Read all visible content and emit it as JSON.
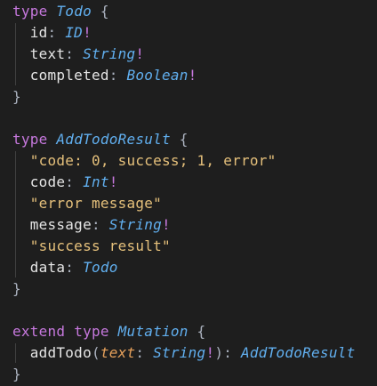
{
  "lines": [
    [
      {
        "t": "type",
        "c": "kw"
      },
      {
        "t": " ",
        "c": "pn"
      },
      {
        "t": "Todo",
        "c": "ty"
      },
      {
        "t": " {",
        "c": "pn"
      }
    ],
    [
      {
        "t": "  ",
        "c": "pn"
      },
      {
        "t": "id",
        "c": "fd"
      },
      {
        "t": ": ",
        "c": "pn"
      },
      {
        "t": "ID",
        "c": "ty"
      },
      {
        "t": "!",
        "c": "op"
      }
    ],
    [
      {
        "t": "  ",
        "c": "pn"
      },
      {
        "t": "text",
        "c": "fd"
      },
      {
        "t": ": ",
        "c": "pn"
      },
      {
        "t": "String",
        "c": "ty"
      },
      {
        "t": "!",
        "c": "op"
      }
    ],
    [
      {
        "t": "  ",
        "c": "pn"
      },
      {
        "t": "completed",
        "c": "fd"
      },
      {
        "t": ": ",
        "c": "pn"
      },
      {
        "t": "Boolean",
        "c": "ty"
      },
      {
        "t": "!",
        "c": "op"
      }
    ],
    [
      {
        "t": "}",
        "c": "pn"
      }
    ],
    [],
    [
      {
        "t": "type",
        "c": "kw"
      },
      {
        "t": " ",
        "c": "pn"
      },
      {
        "t": "AddTodoResult",
        "c": "ty"
      },
      {
        "t": " {",
        "c": "pn"
      }
    ],
    [
      {
        "t": "  ",
        "c": "pn"
      },
      {
        "t": "\"code: 0, success; 1, error\"",
        "c": "str"
      }
    ],
    [
      {
        "t": "  ",
        "c": "pn"
      },
      {
        "t": "code",
        "c": "fd"
      },
      {
        "t": ": ",
        "c": "pn"
      },
      {
        "t": "Int",
        "c": "ty"
      },
      {
        "t": "!",
        "c": "op"
      }
    ],
    [
      {
        "t": "  ",
        "c": "pn"
      },
      {
        "t": "\"error message\"",
        "c": "str"
      }
    ],
    [
      {
        "t": "  ",
        "c": "pn"
      },
      {
        "t": "message",
        "c": "fd"
      },
      {
        "t": ": ",
        "c": "pn"
      },
      {
        "t": "String",
        "c": "ty"
      },
      {
        "t": "!",
        "c": "op"
      }
    ],
    [
      {
        "t": "  ",
        "c": "pn"
      },
      {
        "t": "\"success result\"",
        "c": "str"
      }
    ],
    [
      {
        "t": "  ",
        "c": "pn"
      },
      {
        "t": "data",
        "c": "fd"
      },
      {
        "t": ": ",
        "c": "pn"
      },
      {
        "t": "Todo",
        "c": "ty"
      }
    ],
    [
      {
        "t": "}",
        "c": "pn"
      }
    ],
    [],
    [
      {
        "t": "extend",
        "c": "kw"
      },
      {
        "t": " ",
        "c": "pn"
      },
      {
        "t": "type",
        "c": "kw"
      },
      {
        "t": " ",
        "c": "pn"
      },
      {
        "t": "Mutation",
        "c": "ty"
      },
      {
        "t": " {",
        "c": "pn"
      }
    ],
    [
      {
        "t": "  ",
        "c": "pn"
      },
      {
        "t": "addTodo",
        "c": "fd"
      },
      {
        "t": "(",
        "c": "pn"
      },
      {
        "t": "text",
        "c": "arg"
      },
      {
        "t": ": ",
        "c": "pn"
      },
      {
        "t": "String",
        "c": "ty"
      },
      {
        "t": "!",
        "c": "op"
      },
      {
        "t": "): ",
        "c": "pn"
      },
      {
        "t": "AddTodoResult",
        "c": "ty"
      }
    ],
    [
      {
        "t": "}",
        "c": "pn"
      }
    ]
  ],
  "theme": {
    "background": "#1e1e1e",
    "keyword": "#c678dd",
    "type": "#61afef",
    "string": "#e5c07b",
    "argument": "#e5a05b",
    "punctuation": "#abb2bf",
    "field": "#e5e5e5"
  }
}
